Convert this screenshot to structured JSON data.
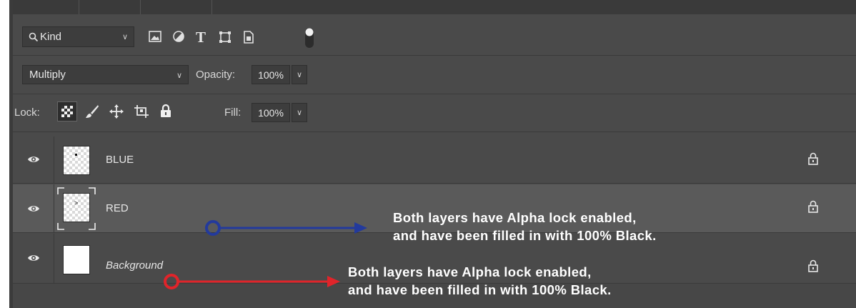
{
  "filter": {
    "kind_label": "Kind",
    "filter_icons": [
      "image-filter-icon",
      "adjustment-filter-icon",
      "type-filter-icon",
      "shape-filter-icon",
      "smart-object-filter-icon",
      "filter-toggle-icon"
    ]
  },
  "blend": {
    "mode": "Multiply",
    "opacity_label": "Opacity:",
    "opacity_value": "100%"
  },
  "locks": {
    "label": "Lock:",
    "icons": [
      "lock-transparent-pixels-icon",
      "lock-image-pixels-icon",
      "lock-position-icon",
      "lock-artboard-icon",
      "lock-all-icon"
    ],
    "fill_label": "Fill:",
    "fill_value": "100%"
  },
  "layers": [
    {
      "name": "BLUE",
      "visible": true,
      "selected": false,
      "italic": false
    },
    {
      "name": "RED",
      "visible": true,
      "selected": true,
      "italic": false
    },
    {
      "name": "Background",
      "visible": true,
      "selected": false,
      "italic": true
    }
  ],
  "annotations": [
    {
      "line1": "Both layers have Alpha lock enabled,",
      "line2": "and have been filled in with 100% Black.",
      "color": "#233a9c"
    },
    {
      "line1": "Both layers have Alpha lock enabled,",
      "line2": "and have been filled in with 100% Black.",
      "color": "#e0242a"
    }
  ],
  "colors": {
    "panel_bg": "#4a4a4a",
    "selected_layer_bg": "#5a5a5a",
    "blue_arrow": "#233a9c",
    "red_arrow": "#e0242a"
  }
}
